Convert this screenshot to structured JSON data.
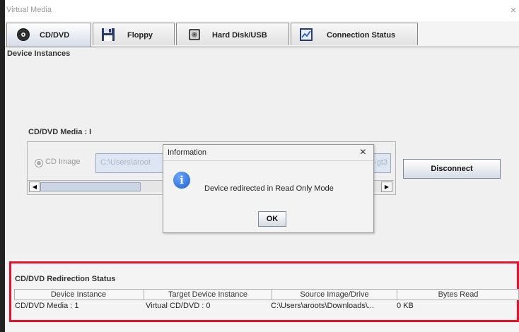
{
  "window": {
    "title": "Virtual Media",
    "close_glyph": "×"
  },
  "tabs": [
    {
      "label": "CD/DVD",
      "icon": "cd-icon",
      "active": true
    },
    {
      "label": "Floppy",
      "icon": "floppy-icon",
      "active": false
    },
    {
      "label": "Hard Disk/USB",
      "icon": "hard-disk-icon",
      "active": false
    },
    {
      "label": "Connection Status",
      "icon": "chart-icon",
      "active": false
    }
  ],
  "device_panel": {
    "section_label": "Device Instances",
    "media_label": "CD/DVD Media : I",
    "radio_label": "CD Image",
    "path_value": "C:\\Users\\aroot",
    "path_tail": "d-gt3",
    "disconnect_label": "Disconnect"
  },
  "dialog": {
    "title": "Information",
    "close_glyph": "×",
    "icon_glyph": "i",
    "message": "Device redirected in Read Only Mode",
    "ok_label": "OK"
  },
  "redirection_status": {
    "section_label": "CD/DVD Redirection Status",
    "columns": [
      "Device Instance",
      "Target Device Instance",
      "Source Image/Drive",
      "Bytes Read"
    ],
    "rows": [
      [
        "CD/DVD Media : 1",
        "Virtual CD/DVD : 0",
        "C:\\Users\\aroots\\Downloads\\...",
        "0 KB"
      ]
    ]
  },
  "colors": {
    "highlight": "#e8102a",
    "info_blue": "#1f5fcf"
  }
}
